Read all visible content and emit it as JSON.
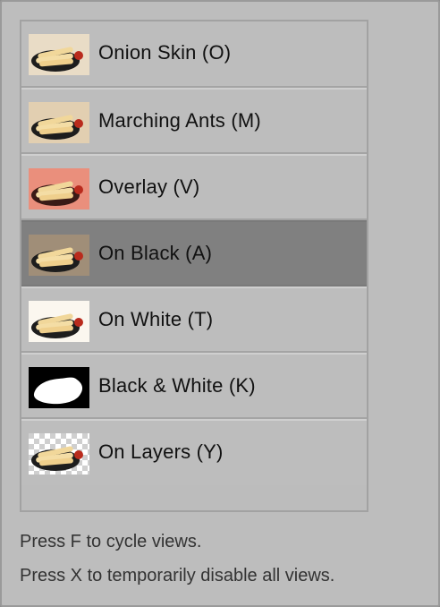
{
  "view_modes": [
    {
      "label": "Onion Skin (O)",
      "thumb": "food-thumbnail-icon"
    },
    {
      "label": "Marching Ants (M)",
      "thumb": "food-thumbnail-icon"
    },
    {
      "label": "Overlay (V)",
      "thumb": "food-overlay-thumbnail-icon"
    },
    {
      "label": "On Black (A)",
      "thumb": "food-thumbnail-icon",
      "selected": true
    },
    {
      "label": "On White (T)",
      "thumb": "food-thumbnail-icon"
    },
    {
      "label": "Black & White (K)",
      "thumb": "mask-thumbnail-icon"
    },
    {
      "label": "On Layers (Y)",
      "thumb": "food-transparency-thumbnail-icon"
    }
  ],
  "help": {
    "line1": "Press F to cycle views.",
    "line2": "Press X to temporarily disable all views."
  },
  "colors": {
    "panel_bg": "#bdbdbd",
    "selected_bg": "#808080",
    "overlay_tint": "#e98f7a"
  }
}
